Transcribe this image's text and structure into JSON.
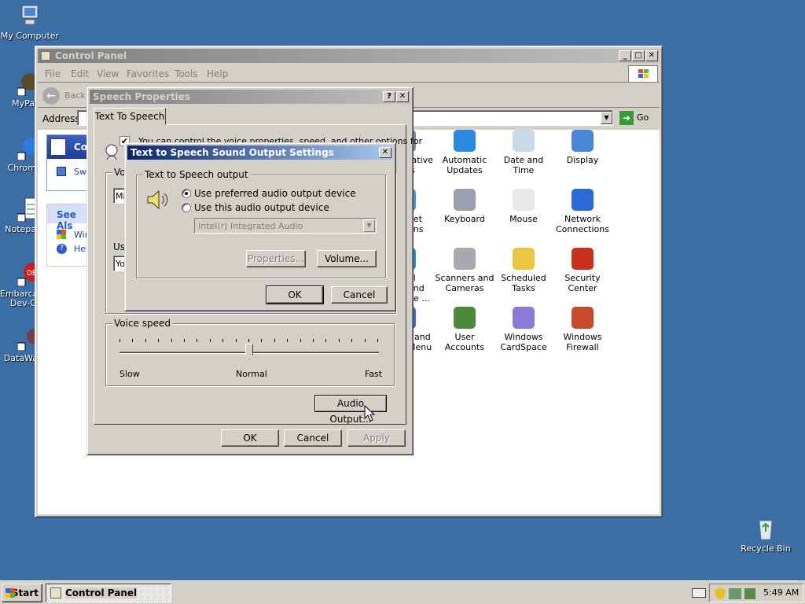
{
  "desktop": {
    "icons": [
      "My Computer",
      "MyPa",
      "Chrom",
      "Notepa",
      "Embarca\nDev-C",
      "DataWa",
      "Recycle Bin"
    ]
  },
  "control_panel": {
    "title": "Control Panel",
    "menu": [
      "File",
      "Edit",
      "View",
      "Favorites",
      "Tools",
      "Help"
    ],
    "back_label": "Back",
    "address_label": "Address",
    "go_label": "Go",
    "left_pane": {
      "see_also": "See Als",
      "item1": "Wir",
      "item2": "Hel",
      "task1": "Sw",
      "cat_title": "Con"
    },
    "items": [
      {
        "label": "rative\nls",
        "icon": "admin-tools-icon"
      },
      {
        "label": "Automatic\nUpdates",
        "icon": "windows-update-icon"
      },
      {
        "label": "Date and Time",
        "icon": "clock-icon"
      },
      {
        "label": "Display",
        "icon": "display-icon"
      },
      {
        "label": "net\nons",
        "icon": "internet-options-icon"
      },
      {
        "label": "Keyboard",
        "icon": "keyboard-icon"
      },
      {
        "label": "Mouse",
        "icon": "mouse-icon"
      },
      {
        "label": "Network\nConnections",
        "icon": "network-icon"
      },
      {
        "label": "al and\nge ...",
        "icon": "regional-icon"
      },
      {
        "label": "Scanners and\nCameras",
        "icon": "scanner-icon"
      },
      {
        "label": "Scheduled\nTasks",
        "icon": "scheduled-tasks-icon"
      },
      {
        "label": "Security\nCenter",
        "icon": "shield-icon"
      },
      {
        "label": "r and\nMenu",
        "icon": "taskbar-icon"
      },
      {
        "label": "User Accounts",
        "icon": "users-icon"
      },
      {
        "label": "Windows\nCardSpace",
        "icon": "cardspace-icon"
      },
      {
        "label": "Windows\nFirewall",
        "icon": "firewall-icon"
      }
    ]
  },
  "speech_props": {
    "title": "Speech Properties",
    "tab": "Text To Speech",
    "desc": "You can control the voice properties, speed, and other options for",
    "voice_group": "Voi",
    "voice_value": "Mi",
    "use_label": "Use",
    "use_value": "Yo",
    "voice_speed_label": "Voice speed",
    "slow": "Slow",
    "normal": "Normal",
    "fast": "Fast",
    "speed_fraction": 0.5,
    "audio_output_btn": "Audio Output...",
    "ok": "OK",
    "cancel": "Cancel",
    "apply": "Apply"
  },
  "sound_dialog": {
    "title": "Text to Speech Sound Output Settings",
    "group_label": "Text to Speech output",
    "radio1": "Use preferred audio output device",
    "radio2": "Use this audio output device",
    "device": "Intel(r) Integrated Audio",
    "properties_btn": "Properties...",
    "volume_btn": "Volume...",
    "ok": "OK",
    "cancel": "Cancel"
  },
  "taskbar": {
    "start": "Start",
    "task": "Control Panel",
    "clock": "5:49 AM"
  },
  "colors": {
    "desktop": "#3a6ea5",
    "title_active": "#0a246a",
    "title_inactive": "#808080"
  }
}
